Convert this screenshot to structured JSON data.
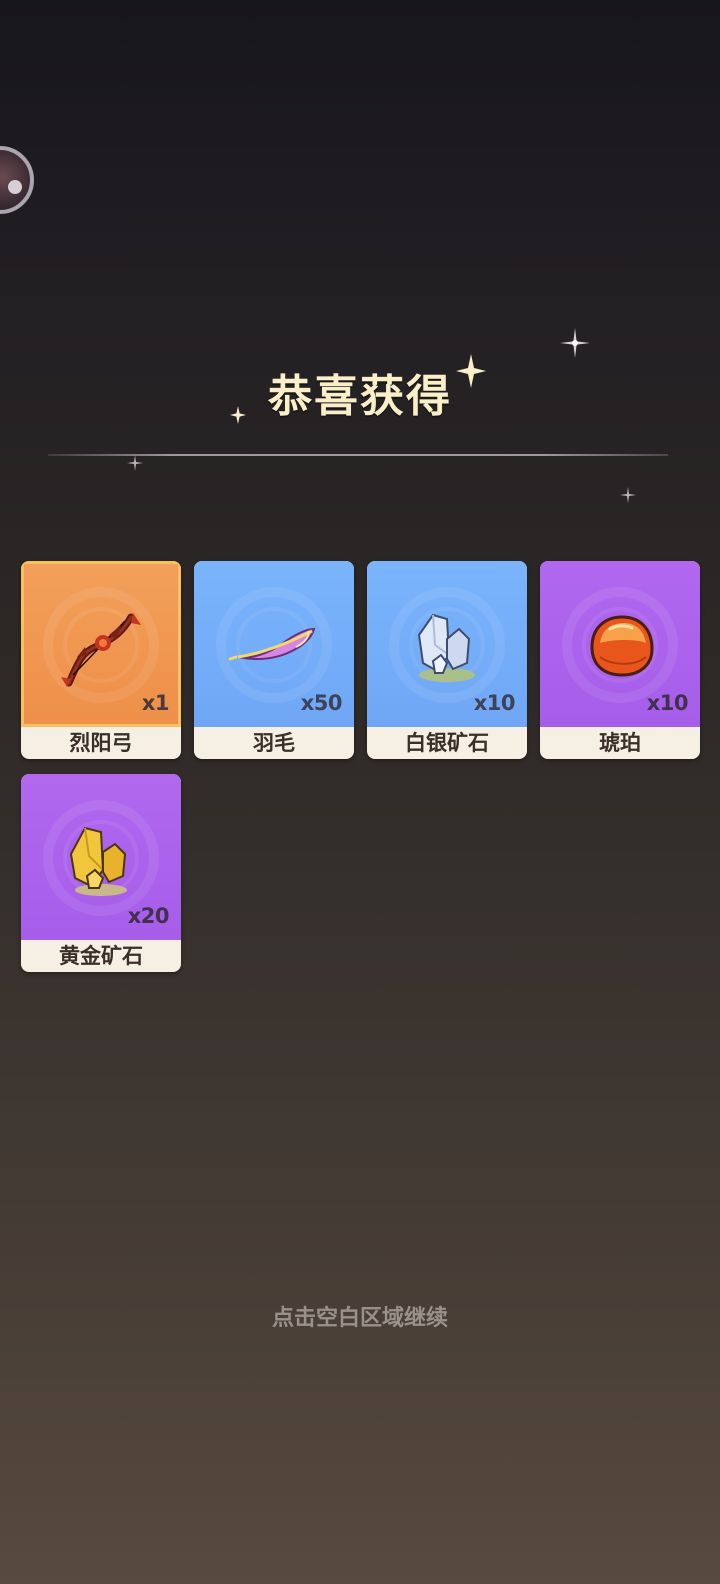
{
  "title": "恭喜获得",
  "items": [
    {
      "name": "烈阳弓",
      "count": "x1",
      "rarity": "orange",
      "icon": "bow-icon"
    },
    {
      "name": "羽毛",
      "count": "x50",
      "rarity": "blue",
      "icon": "feather-icon"
    },
    {
      "name": "白银矿石",
      "count": "x10",
      "rarity": "blue",
      "icon": "silver-ore-icon"
    },
    {
      "name": "琥珀",
      "count": "x10",
      "rarity": "purple",
      "icon": "amber-icon"
    },
    {
      "name": "黄金矿石",
      "count": "x20",
      "rarity": "purple",
      "icon": "gold-ore-icon"
    }
  ],
  "footer_tip": "点击空白区域继续",
  "colors": {
    "title": "#fbefc9",
    "orange": "#ee8f48",
    "blue": "#6fa7f6",
    "purple": "#a65de9",
    "label_bg": "#f6f0e4"
  }
}
